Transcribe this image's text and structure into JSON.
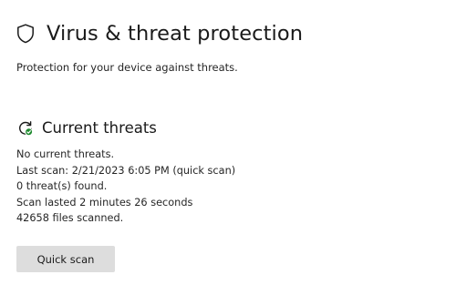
{
  "header": {
    "title": "Virus & threat protection",
    "icon": "shield-icon"
  },
  "subtitle": "Protection for your device against threats.",
  "current_threats": {
    "title": "Current threats",
    "icon": "refresh-check-icon",
    "status": "No current threats.",
    "last_scan": "Last scan: 2/21/2023 6:05 PM (quick scan)",
    "threats_found": "0 threat(s) found.",
    "scan_duration": "Scan lasted 2 minutes 26 seconds",
    "files_scanned": "42658 files scanned.",
    "quick_scan_label": "Quick scan"
  },
  "colors": {
    "button_background": "#dddddd",
    "badge_green": "#1e8a2e",
    "text": "#1a1a1a"
  }
}
